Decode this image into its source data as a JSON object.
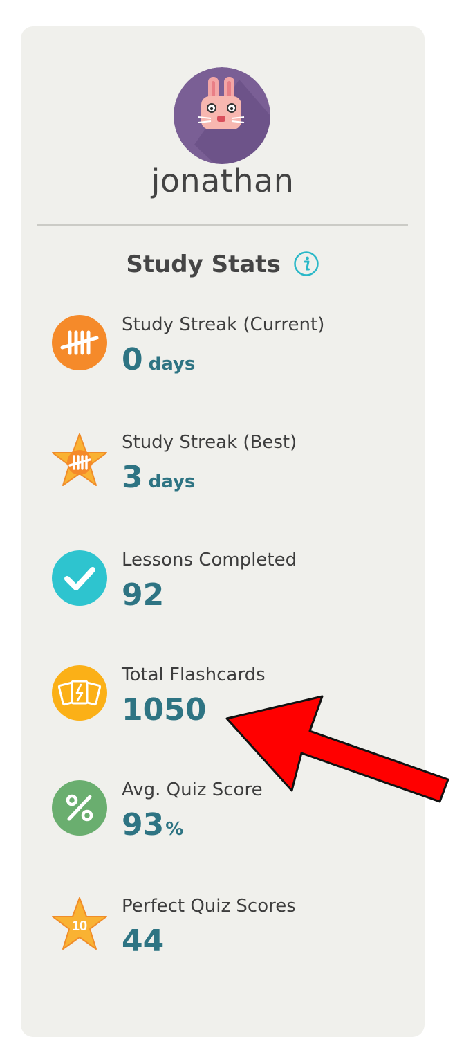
{
  "profile": {
    "username": "jonathan",
    "avatar_icon": "bunny-avatar-icon"
  },
  "study_stats": {
    "title": "Study Stats",
    "info_icon": "info-icon",
    "items": [
      {
        "label": "Study Streak (Current)",
        "value": "0",
        "unit": "days",
        "icon": "tally-marks-icon",
        "color": "#f58a2a"
      },
      {
        "label": "Study Streak (Best)",
        "value": "3",
        "unit": "days",
        "icon": "star-tally-icon",
        "color": "#f9b233"
      },
      {
        "label": "Lessons Completed",
        "value": "92",
        "unit": "",
        "icon": "checkmark-icon",
        "color": "#2ec4cf"
      },
      {
        "label": "Total Flashcards",
        "value": "1050",
        "unit": "",
        "icon": "flashcards-icon",
        "color": "#fbb017"
      },
      {
        "label": "Avg. Quiz Score",
        "value": "93",
        "unit": "%",
        "icon": "percent-icon",
        "color": "#6aae6f"
      },
      {
        "label": "Perfect Quiz Scores",
        "value": "44",
        "unit": "",
        "icon": "star-ten-icon",
        "color": "#f9b233",
        "badge_text": "10"
      }
    ]
  },
  "annotation": {
    "arrow_color": "#ff0000"
  }
}
